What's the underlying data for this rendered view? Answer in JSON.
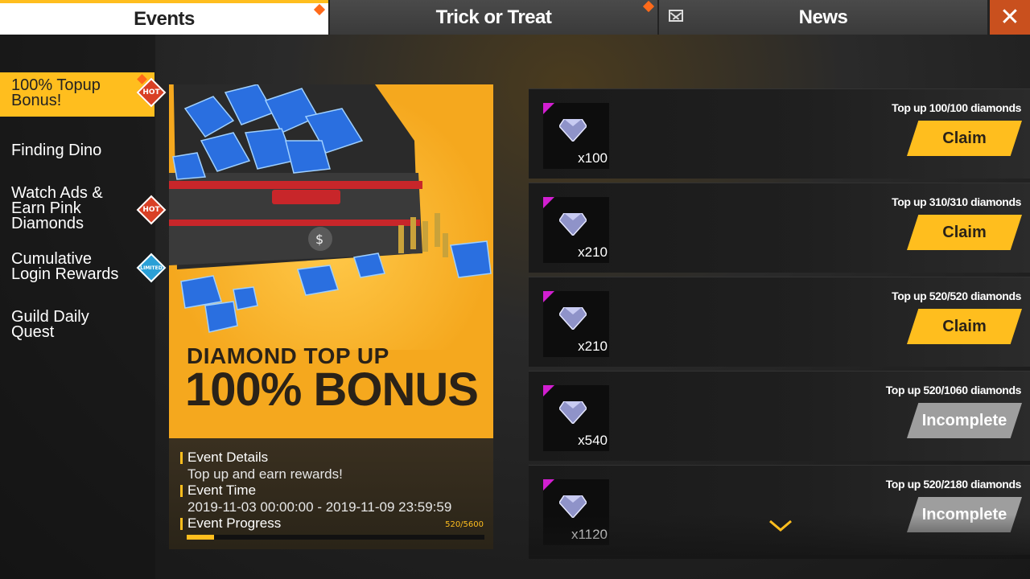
{
  "tabs": [
    {
      "label": "Events",
      "active": true
    },
    {
      "label": "Trick or Treat",
      "active": false
    },
    {
      "label": "News",
      "active": false
    }
  ],
  "close_icon": "close-icon",
  "sidebar": {
    "items": [
      {
        "label": "100% Topup Bonus!",
        "badge": "HOT",
        "active": true
      },
      {
        "label": "Finding Dino",
        "badge": ""
      },
      {
        "label": "Watch Ads & Earn Pink Diamonds",
        "badge": "HOT"
      },
      {
        "label": "Cumulative Login Rewards",
        "badge": "LIMITED"
      },
      {
        "label": "Guild Daily Quest",
        "badge": ""
      }
    ]
  },
  "banner": {
    "headline_small": "DIAMOND TOP UP",
    "headline_big": "100% BONUS",
    "details_label": "Event Details",
    "details_text": "Top up and earn rewards!",
    "time_label": "Event Time",
    "time_text": "2019-11-03 00:00:00 - 2019-11-09 23:59:59",
    "progress_label": "Event Progress",
    "progress_text": "520/5600",
    "progress_fraction": 0.093
  },
  "rewards": [
    {
      "label": "Top up 100/100 diamonds",
      "qty": "x100",
      "button": "Claim",
      "state": "claim"
    },
    {
      "label": "Top up 310/310 diamonds",
      "qty": "x210",
      "button": "Claim",
      "state": "claim"
    },
    {
      "label": "Top up 520/520 diamonds",
      "qty": "x210",
      "button": "Claim",
      "state": "claim"
    },
    {
      "label": "Top up 520/1060 diamonds",
      "qty": "x540",
      "button": "Incomplete",
      "state": "incomplete"
    },
    {
      "label": "Top up 520/2180 diamonds",
      "qty": "x1120",
      "button": "Incomplete",
      "state": "incomplete"
    }
  ],
  "colors": {
    "accent": "#ffbe1e",
    "close": "#c9501e",
    "hot": "#d94025",
    "limited": "#2a9fd6",
    "rarity": "#d21fd1"
  }
}
